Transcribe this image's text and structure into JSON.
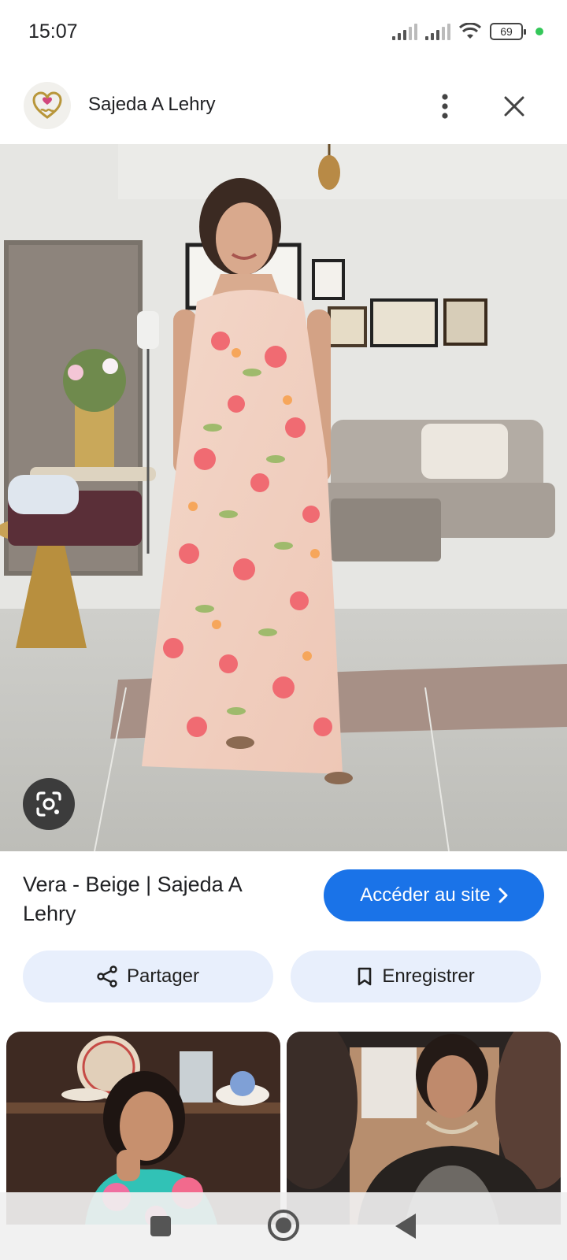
{
  "status_bar": {
    "time": "15:07",
    "battery": "69"
  },
  "header": {
    "site_name": "Sajeda A Lehry",
    "logo_icon": "heart-monogram-logo",
    "more_icon": "more-vert-icon",
    "close_icon": "close-icon"
  },
  "main_image": {
    "lens_icon": "google-lens-icon"
  },
  "result": {
    "title": "Vera - Beige | Sajeda A Lehry",
    "visit_label": "Accéder au site",
    "visit_icon": "chevron-right-icon",
    "share_label": "Partager",
    "share_icon": "share-icon",
    "save_label": "Enregistrer",
    "save_icon": "bookmark-icon"
  },
  "colors": {
    "accent": "#1a73e8",
    "action_bg": "#e8effc"
  }
}
